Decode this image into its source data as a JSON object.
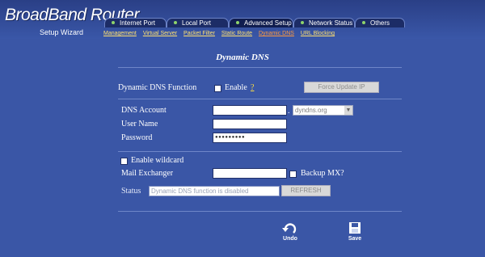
{
  "header": {
    "brand": "BroadBand Router",
    "wizard": "Setup Wizard",
    "tabs": [
      {
        "label": "Internet Port"
      },
      {
        "label": "Local Port"
      },
      {
        "label": "Advanced Setup"
      },
      {
        "label": "Network Status"
      },
      {
        "label": "Others"
      }
    ],
    "subnav": [
      {
        "label": "Management"
      },
      {
        "label": "Virtual Server"
      },
      {
        "label": "Packet Filter"
      },
      {
        "label": "Static Route"
      },
      {
        "label": "Dynamic DNS"
      },
      {
        "label": "URL Blocking"
      }
    ],
    "colors": {
      "background": "#3a56a6",
      "link": "#ffe070",
      "current_link": "#ff9a40"
    }
  },
  "panel": {
    "title": "Dynamic DNS",
    "ddns_function_label": "Dynamic DNS Function",
    "enable_label": "Enable",
    "help_mark": "?",
    "force_update_label": "Force Update IP",
    "account_label": "DNS Account",
    "account_value": "",
    "account_dot": ".",
    "domain_selected": "dyndns.org",
    "username_label": "User Name",
    "username_value": "",
    "password_label": "Password",
    "password_value": "●●●●●●●●●",
    "wildcard_label": "Enable wildcard",
    "mx_label": "Mail Exchanger",
    "mx_value": "",
    "backup_mx_label": "Backup MX?",
    "status_label": "Status",
    "status_value": "Dynamic DNS function is disabled",
    "refresh_label": "REFRESH",
    "undo_label": "Undo",
    "save_label": "Save"
  }
}
